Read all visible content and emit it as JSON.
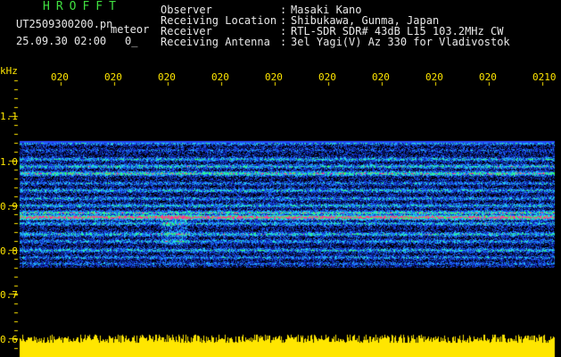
{
  "header": {
    "app_title": "HROFFT",
    "filename": "UT2509300200.pn",
    "mode": "meteor",
    "datetime": "25.09.30 02:00",
    "count": "0_",
    "meta": [
      {
        "label": "Observer",
        "value": "Masaki Kano"
      },
      {
        "label": "Receiving Location",
        "value": "Shibukawa, Gunma, Japan"
      },
      {
        "label": "Receiver",
        "value": "RTL-SDR SDR# 43dB L15 103.2MHz CW"
      },
      {
        "label": "Receiving Antenna",
        "value": "3el Yagi(V) Az 330 for Vladivostok"
      }
    ]
  },
  "axis": {
    "unit": "kHz",
    "freq_ticks": [
      "1.1",
      "1.0",
      "0.9",
      "0.8",
      "0.7",
      "0.6"
    ],
    "time_ticks": [
      "020",
      "020",
      "020",
      "020",
      "020",
      "020",
      "020",
      "020",
      "020",
      "0210"
    ]
  },
  "colors": {
    "text_green": "#40e040",
    "text_white": "#e8e8e8",
    "axis_yellow": "#ffe600",
    "background": "#000000"
  }
}
